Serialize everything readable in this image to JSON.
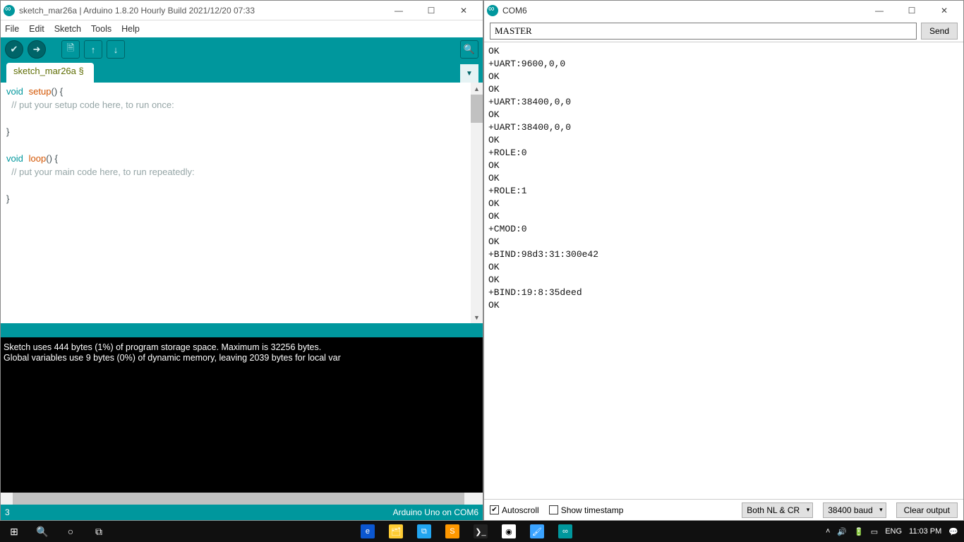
{
  "ide": {
    "title": "sketch_mar26a | Arduino 1.8.20 Hourly Build 2021/12/20 07:33",
    "menu": [
      "File",
      "Edit",
      "Sketch",
      "Tools",
      "Help"
    ],
    "tab": "sketch_mar26a §",
    "code": {
      "l1a": "void",
      "l1b": "setup",
      "l1c": "() {",
      "l2": "  // put your setup code here, to run once:",
      "l3": "",
      "l4": "}",
      "l5": "",
      "l6a": "void",
      "l6b": "loop",
      "l6c": "() {",
      "l7": "  // put your main code here, to run repeatedly:",
      "l8": "",
      "l9": "}"
    },
    "console_l1": "Sketch uses 444 bytes (1%) of program storage space. Maximum is 32256 bytes.",
    "console_l2": "Global variables use 9 bytes (0%) of dynamic memory, leaving 2039 bytes for local var",
    "status_left": "3",
    "status_right": "Arduino Uno on COM6"
  },
  "serial": {
    "title": "COM6",
    "input": "MASTER",
    "send": "Send",
    "output": "OK\n+UART:9600,0,0\nOK\nOK\n+UART:38400,0,0\nOK\n+UART:38400,0,0\nOK\n+ROLE:0\nOK\nOK\n+ROLE:1\nOK\nOK\n+CMOD:0\nOK\n+BIND:98d3:31:300e42\nOK\nOK\n+BIND:19:8:35deed\nOK",
    "autoscroll": "Autoscroll",
    "timestamp": "Show timestamp",
    "lineend": "Both NL & CR",
    "baud": "38400 baud",
    "clear": "Clear output"
  },
  "taskbar": {
    "lang": "ENG",
    "time": "11:03 PM"
  }
}
